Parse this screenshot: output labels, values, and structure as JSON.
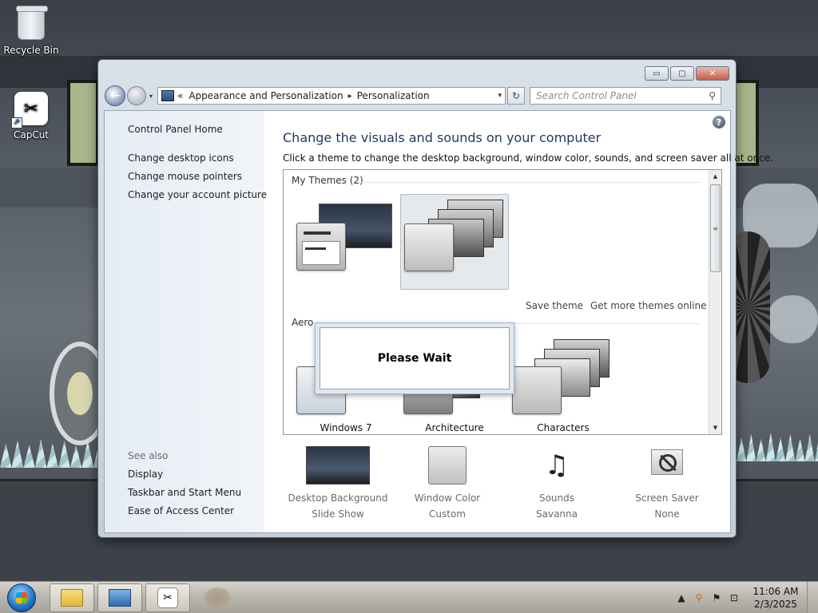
{
  "desktop": {
    "icons": [
      {
        "label": "Recycle Bin",
        "icon": "recycle-bin-icon"
      },
      {
        "label": "CapCut",
        "icon": "capcut-icon"
      }
    ]
  },
  "window": {
    "controls": {
      "minimize": "▭",
      "maximize": "▢",
      "close": "✕"
    },
    "nav": {
      "back_glyph": "←",
      "breadcrumb_prefix": "«",
      "breadcrumb": [
        "Appearance and Personalization",
        "Personalization"
      ],
      "separator": "▸",
      "dropdown_glyph": "▾",
      "refresh_glyph": "↻",
      "search_placeholder": "Search Control Panel"
    },
    "left_pane": {
      "home": "Control Panel Home",
      "links": [
        "Change desktop icons",
        "Change mouse pointers",
        "Change your account picture"
      ],
      "see_also_label": "See also",
      "see_also": [
        "Display",
        "Taskbar and Start Menu",
        "Ease of Access Center"
      ]
    },
    "main": {
      "help_glyph": "?",
      "heading": "Change the visuals and sounds on your computer",
      "subtitle": "Click a theme to change the desktop background, window color, sounds, and screen saver all at once.",
      "groups": {
        "my_themes": "My Themes (2)",
        "aero_partial": "Aero"
      },
      "save_theme": "Save theme",
      "get_more": "Get more themes online",
      "aero_themes": [
        "Windows 7",
        "Architecture",
        "Characters"
      ],
      "dialog": {
        "text": "Please Wait"
      },
      "scroll": {
        "up": "▲",
        "down": "▼",
        "grip": "≡"
      }
    },
    "bottom": [
      {
        "label": "Desktop Background",
        "value": "Slide Show"
      },
      {
        "label": "Window Color",
        "value": "Custom"
      },
      {
        "label": "Sounds",
        "value": "Savanna"
      },
      {
        "label": "Screen Saver",
        "value": "None"
      }
    ]
  },
  "taskbar": {
    "tray": {
      "arrow": "▲",
      "search": "⚲",
      "flag": "⚑",
      "network": "⊡"
    },
    "clock": {
      "time": "11:06 AM",
      "date": "2/3/2025"
    }
  }
}
